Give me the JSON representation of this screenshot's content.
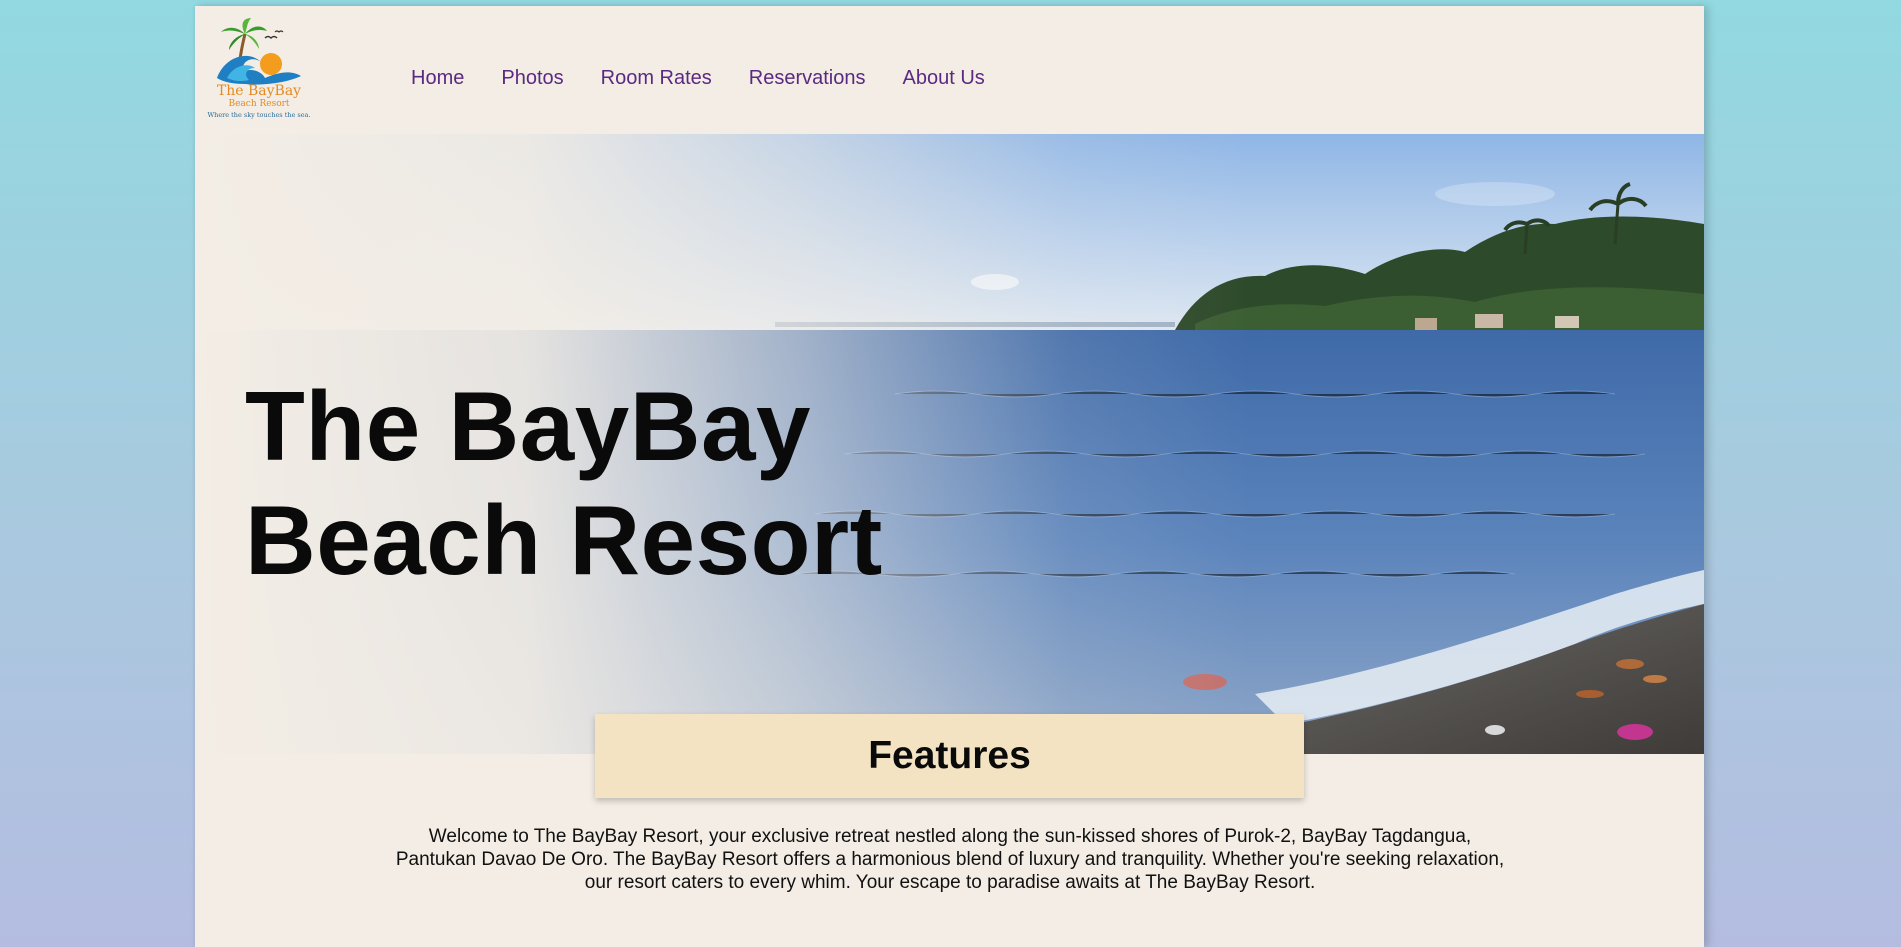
{
  "logo": {
    "title": "The BayBay",
    "subtitle": "Beach Resort",
    "tagline": "Where the sky touches the sea."
  },
  "nav": {
    "items": [
      {
        "label": "Home"
      },
      {
        "label": "Photos"
      },
      {
        "label": "Room Rates"
      },
      {
        "label": "Reservations"
      },
      {
        "label": "About Us"
      }
    ]
  },
  "hero": {
    "title_line1": "The BayBay",
    "title_line2": "Beach Resort"
  },
  "features": {
    "heading": "Features",
    "intro": "Welcome to The BayBay Resort, your exclusive retreat nestled along the sun-kissed shores of Purok-2, BayBay Tagdangua, Pantukan Davao De Oro. The BayBay Resort offers a harmonious blend of luxury and tranquility. Whether you're seeking relaxation, our resort caters to every whim. Your escape to paradise awaits at The BayBay Resort."
  },
  "colors": {
    "page_background": "#f3ede5",
    "nav_link": "#5a2a82",
    "features_box": "#f3e3c3",
    "logo_orange": "#e58a1f",
    "logo_blue": "#2c6e98"
  },
  "icons": {
    "logo": "palm-tree-wave-sun-logo"
  }
}
